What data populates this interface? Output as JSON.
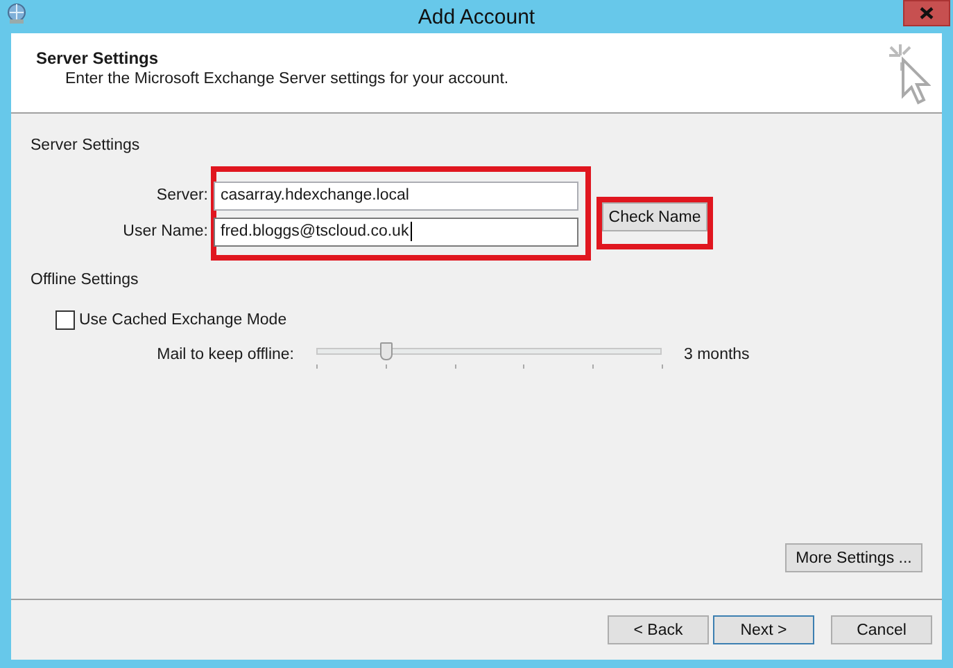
{
  "window": {
    "title": "Add Account"
  },
  "header": {
    "title": "Server Settings",
    "subtitle": "Enter the Microsoft Exchange Server settings for your account."
  },
  "server_settings": {
    "heading": "Server Settings",
    "fields": [
      {
        "label": "Server:",
        "value": "casarray.hdexchange.local",
        "focused": false
      },
      {
        "label": "User Name:",
        "value": "fred.bloggs@tscloud.co.uk",
        "focused": true
      }
    ],
    "fields_highlighted": true,
    "check_name": {
      "label": "Check Name",
      "highlighted": true
    }
  },
  "offline_settings": {
    "heading": "Offline Settings",
    "cached_mode": {
      "label": "Use Cached Exchange Mode",
      "checked": false
    },
    "mail_to_keep": {
      "label": "Mail to keep offline:",
      "level": 0.2,
      "reading": "3 months"
    }
  },
  "more_settings": "More Settings ...",
  "buttons": [
    {
      "label": "< Back",
      "default": false
    },
    {
      "label": "Next >",
      "default": true
    },
    {
      "label": "Cancel",
      "default": false
    }
  ]
}
